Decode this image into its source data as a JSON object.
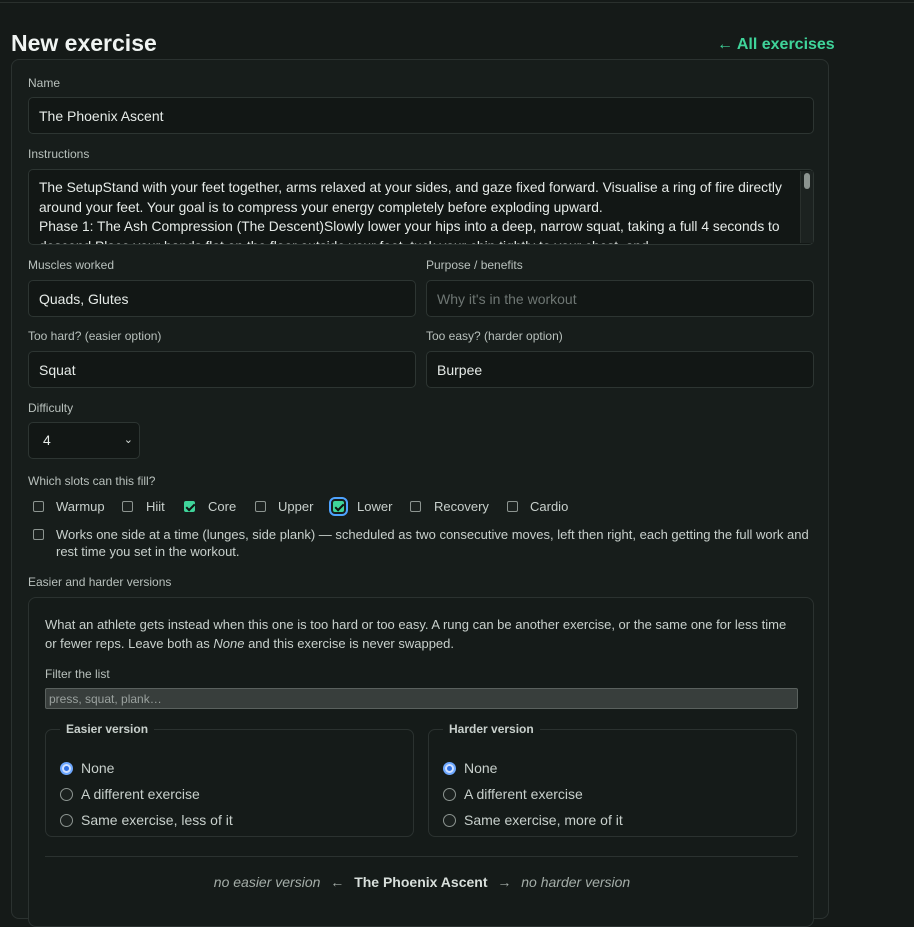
{
  "page": {
    "title": "New exercise",
    "back_link": "← All exercises"
  },
  "form": {
    "name_label": "Name",
    "name_value": "The Phoenix Ascent",
    "instructions_label": "Instructions",
    "instructions_value": "The SetupStand with your feet together, arms relaxed at your sides, and gaze fixed forward. Visualise a ring of fire directly around your feet. Your goal is to compress your energy completely before exploding upward.\nPhase 1: The Ash Compression (The Descent)Slowly lower your hips into a deep, narrow squat, taking a full 4 seconds to descend.Place your hands flat on the floor outside your feet, tuck your chin tightly to your chest, and",
    "muscles_label": "Muscles worked",
    "muscles_value": "Quads, Glutes",
    "purpose_label": "Purpose / benefits",
    "purpose_placeholder": "Why it's in the workout",
    "easier_option_label": "Too hard? (easier option)",
    "easier_option_value": "Squat",
    "harder_option_label": "Too easy? (harder option)",
    "harder_option_value": "Burpee",
    "difficulty_label": "Difficulty",
    "difficulty_value": "4",
    "slots_label": "Which slots can this fill?",
    "slots": [
      {
        "label": "Warmup",
        "checked": false
      },
      {
        "label": "Hiit",
        "checked": false
      },
      {
        "label": "Core",
        "checked": true
      },
      {
        "label": "Upper",
        "checked": false
      },
      {
        "label": "Lower",
        "checked": true
      },
      {
        "label": "Recovery",
        "checked": false
      },
      {
        "label": "Cardio",
        "checked": false
      }
    ],
    "unilateral_label": "Works one side at a time (lunges, side plank) — scheduled as two consecutive moves, left then right, each getting the full work and rest time you set in the workout.",
    "unilateral_checked": false
  },
  "versions": {
    "section_label": "Easier and harder versions",
    "intro_part1": "What an athlete gets instead when this one is too hard or too easy. A rung can be another exercise, or the same one for less time or fewer reps. Leave both as ",
    "intro_em": "None",
    "intro_part2": " and this exercise is never swapped.",
    "filter_label": "Filter the list",
    "filter_placeholder": "press, squat, plank…",
    "easier": {
      "legend": "Easier version",
      "options": [
        "None",
        "A different exercise",
        "Same exercise, less of it"
      ],
      "selected": "None"
    },
    "harder": {
      "legend": "Harder version",
      "options": [
        "None",
        "A different exercise",
        "Same exercise, more of it"
      ],
      "selected": "None"
    },
    "ladder": {
      "easier_text": "no easier version",
      "arrow_left": "←",
      "current": "The Phoenix Ascent",
      "arrow_right": "→",
      "harder_text": "no harder version"
    }
  }
}
